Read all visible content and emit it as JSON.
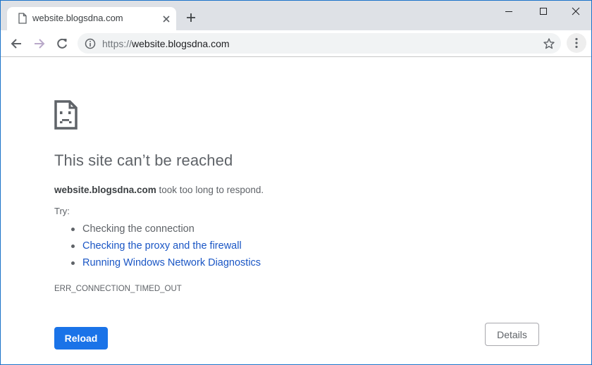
{
  "browser": {
    "tab": {
      "title": "website.blogsdna.com",
      "icon": "page-icon",
      "close_icon": "close-icon"
    },
    "new_tab_icon": "plus-icon",
    "window_controls": {
      "minimize_icon": "minimize-icon",
      "maximize_icon": "maximize-icon",
      "close_icon": "close-icon"
    },
    "toolbar": {
      "back_icon": "arrow-left-icon",
      "forward_icon": "arrow-right-icon",
      "reload_icon": "reload-icon",
      "omnibox": {
        "info_icon": "info-icon",
        "scheme": "https://",
        "host": "website.blogsdna.com",
        "bookmark_icon": "star-icon"
      },
      "menu_icon": "kebab-menu-icon"
    }
  },
  "error_page": {
    "icon": "sad-page-icon",
    "heading": "This site can’t be reached",
    "message_host": "website.blogsdna.com",
    "message_rest": " took too long to respond.",
    "try_label": "Try:",
    "suggestions": [
      {
        "label": "Checking the connection",
        "link": false
      },
      {
        "label": "Checking the proxy and the firewall",
        "link": true
      },
      {
        "label": "Running Windows Network Diagnostics",
        "link": true
      }
    ],
    "error_code": "ERR_CONNECTION_TIMED_OUT",
    "reload_label": "Reload",
    "details_label": "Details"
  },
  "colors": {
    "accent": "#1a73e8",
    "link": "#1a56c5",
    "text": "#5f6368",
    "titlebar": "#dee1e6"
  }
}
